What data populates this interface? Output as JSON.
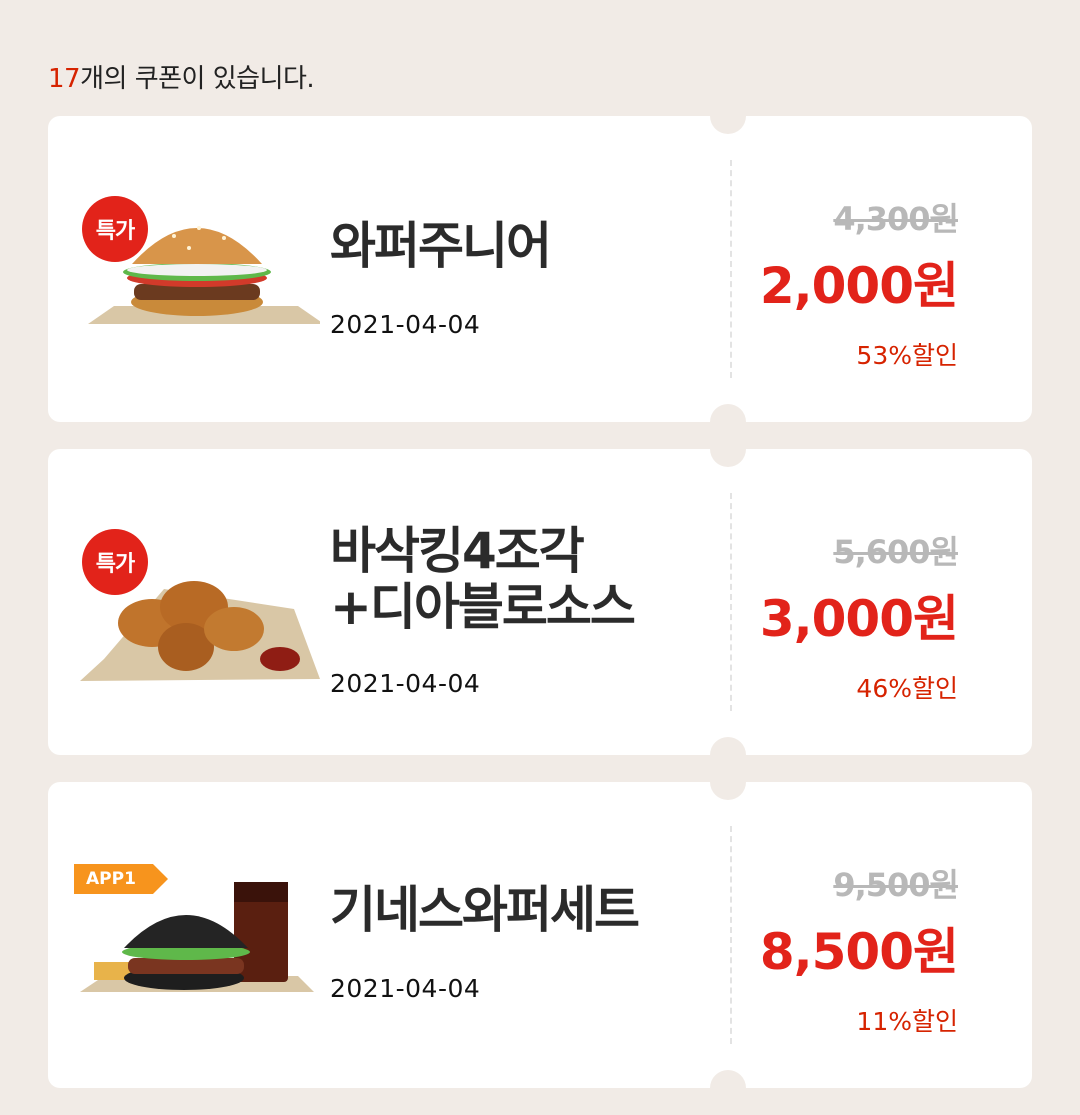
{
  "header": {
    "count": "17",
    "text": "개의 쿠폰이 있습니다."
  },
  "coupons": [
    {
      "badge": "특가",
      "name": "와퍼주니어",
      "date": "2021-04-04",
      "original_price": "4,300원",
      "sale_price": "2,000원",
      "discount": "53%할인",
      "image": "whopper-junior-burger"
    },
    {
      "badge": "특가",
      "name": "바삭킹4조각\n+디아블로소스",
      "date": "2021-04-04",
      "original_price": "5,600원",
      "sale_price": "3,000원",
      "discount": "46%할인",
      "image": "fried-chicken-with-sauce"
    },
    {
      "badge": "APP1",
      "name": "기네스와퍼세트",
      "date": "2021-04-04",
      "original_price": "9,500원",
      "sale_price": "8,500원",
      "discount": "11%할인",
      "image": "guinness-whopper-set-with-coke"
    }
  ],
  "colors": {
    "accent": "#e2231a",
    "background": "#f1ebe6",
    "app_badge": "#f7941d"
  }
}
